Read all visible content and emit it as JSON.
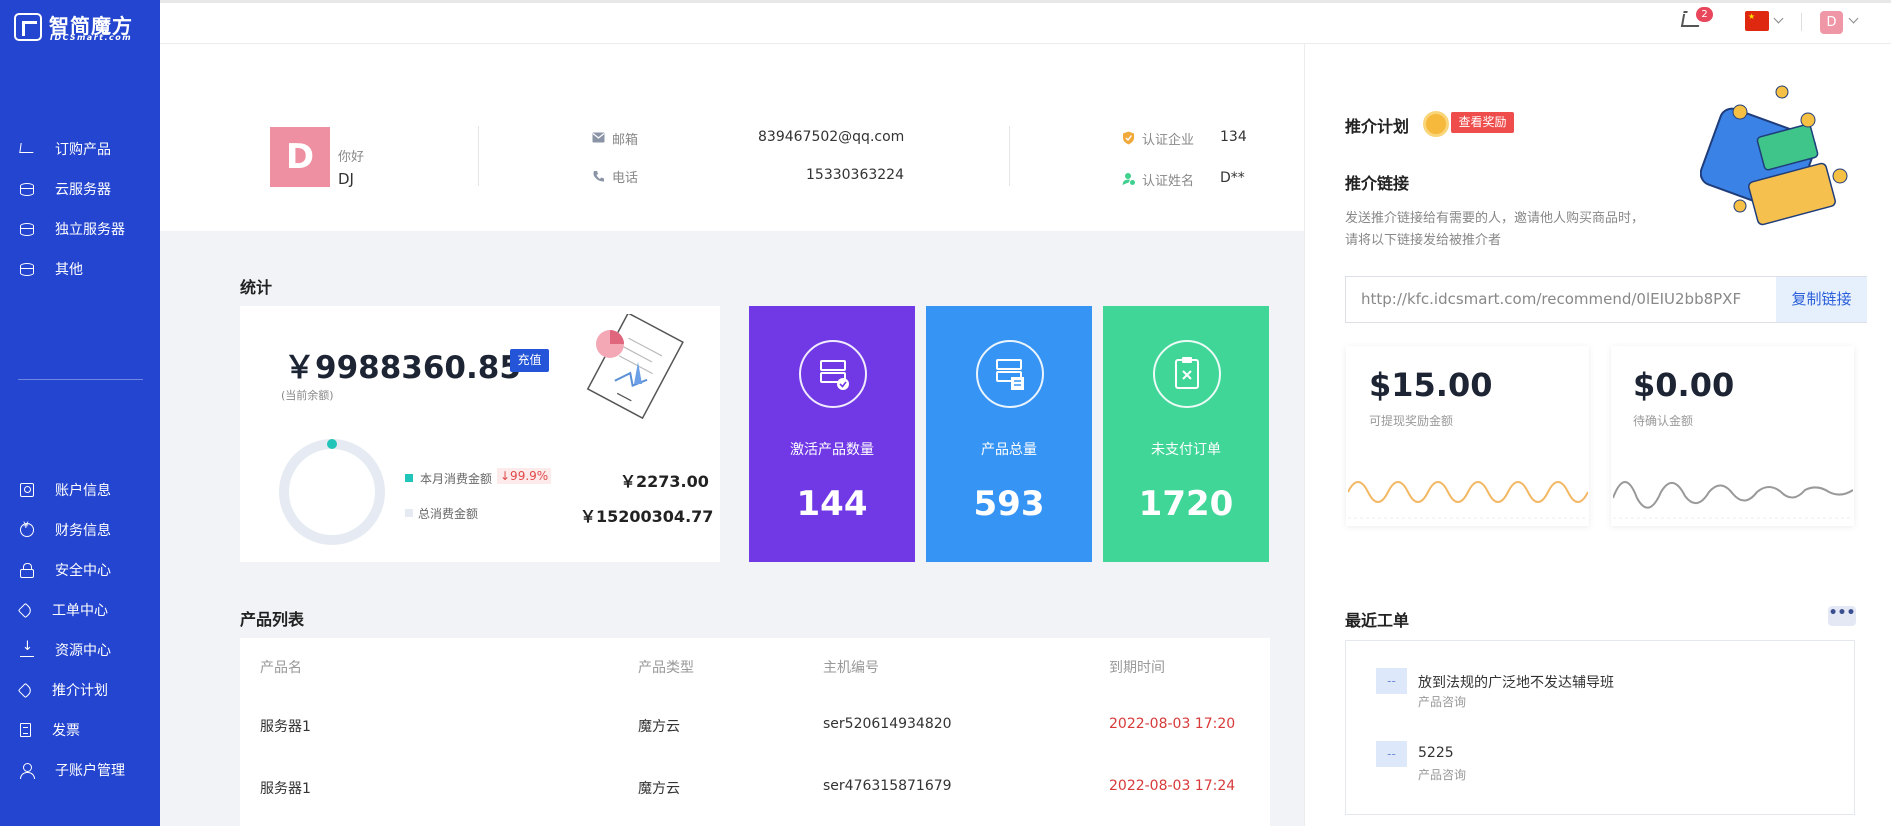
{
  "brand": {
    "name": "智简魔方",
    "sub": "IDCSmart.com"
  },
  "sidebar": {
    "top_items": [
      {
        "label": "订购产品",
        "icon": "cart-icon"
      },
      {
        "label": "云服务器",
        "icon": "database-icon"
      },
      {
        "label": "独立服务器",
        "icon": "database-icon"
      },
      {
        "label": "其他",
        "icon": "database-icon"
      }
    ],
    "bottom_items": [
      {
        "label": "账户信息",
        "icon": "user-card-icon"
      },
      {
        "label": "财务信息",
        "icon": "coin-icon"
      },
      {
        "label": "安全中心",
        "icon": "lock-icon"
      },
      {
        "label": "工单中心",
        "icon": "tag-icon"
      },
      {
        "label": "资源中心",
        "icon": "download-icon"
      },
      {
        "label": "推介计划",
        "icon": "tag-icon"
      },
      {
        "label": "发票",
        "icon": "document-icon"
      },
      {
        "label": "子账户管理",
        "icon": "person-icon"
      }
    ]
  },
  "topbar": {
    "cart_count": "2",
    "user_initial": "D"
  },
  "profile": {
    "avatar_letter": "D",
    "greeting": "你好",
    "name": "DJ",
    "email_label": "邮箱",
    "email": "839467502@qq.com",
    "phone_label": "电话",
    "phone": "15330363224",
    "company_label": "认证企业",
    "company": "134",
    "realname_label": "认证姓名",
    "realname": "D**"
  },
  "stats": {
    "title": "统计",
    "balance": "￥9988360.85",
    "recharge": "充值",
    "balance_label": "(当前余额)",
    "month_label": "本月消费金额",
    "month_change": "↓99.9%",
    "month_amount": "￥2273.00",
    "total_label": "总消费金额",
    "total_amount": "￥15200304.77",
    "tiles": [
      {
        "label": "激活产品数量",
        "value": "144",
        "color": "#7139e6"
      },
      {
        "label": "产品总量",
        "value": "593",
        "color": "#3694f5"
      },
      {
        "label": "未支付订单",
        "value": "1720",
        "color": "#3fd698"
      }
    ]
  },
  "products": {
    "title": "产品列表",
    "columns": [
      "产品名",
      "产品类型",
      "主机编号",
      "到期时间"
    ],
    "rows": [
      [
        "服务器1",
        "魔方云",
        "ser520614934820",
        "2022-08-03 17:20"
      ],
      [
        "服务器1",
        "魔方云",
        "ser476315871679",
        "2022-08-03 17:24"
      ]
    ]
  },
  "referral": {
    "title": "推介计划",
    "reward_button": "查看奖励",
    "link_title": "推介链接",
    "desc_line1": "发送推介链接给有需要的人，邀请他人购买商品时，",
    "desc_line2": "请将以下链接发给被推介者",
    "link": "http://kfc.idcsmart.com/recommend/0lEIU2bb8PXF",
    "copy_button": "复制链接",
    "withdrawable": "$15.00",
    "withdrawable_label": "可提现奖励金额",
    "pending": "$0.00",
    "pending_label": "待确认金额"
  },
  "tickets": {
    "title": "最近工单",
    "items": [
      {
        "title": "放到法规的广泛地不发达辅导班",
        "type": "产品咨询",
        "status": "--"
      },
      {
        "title": "5225",
        "type": "产品咨询",
        "status": "--"
      }
    ]
  },
  "colors": {
    "sidebar": "#2445cf",
    "accent": "#2455d8",
    "danger": "#d83a3a"
  }
}
